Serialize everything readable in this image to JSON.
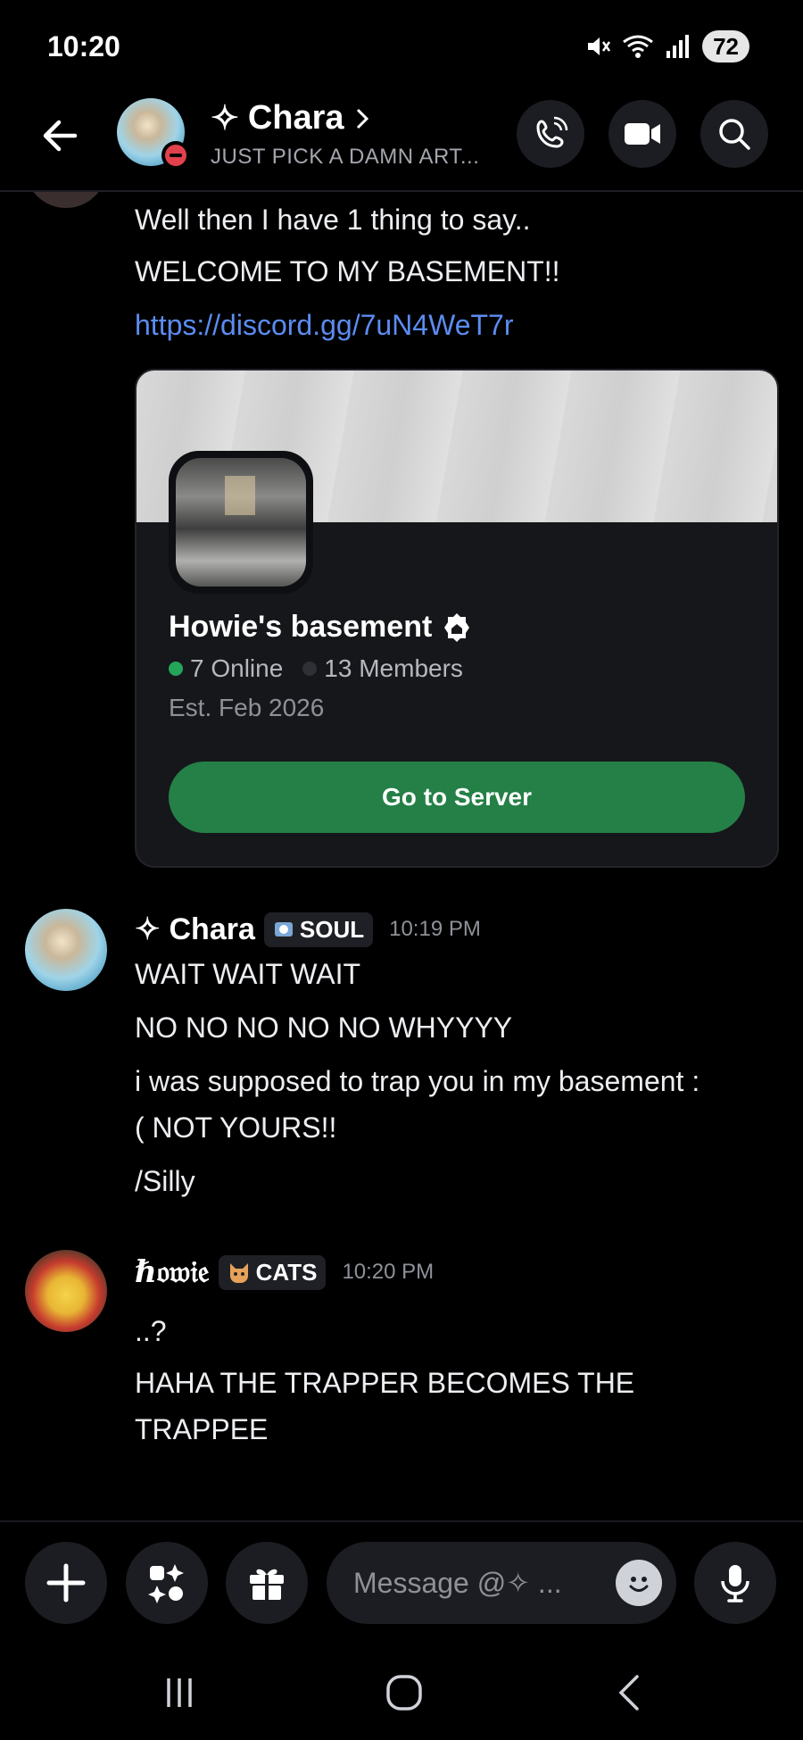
{
  "status_bar": {
    "time": "10:20",
    "battery": "72"
  },
  "header": {
    "title": "Chara",
    "title_prefix": "✧",
    "subtitle": "JUST PICK A DAMN ART..."
  },
  "messages": {
    "partial": {
      "lines": [
        "Well then I have 1 thing to say..",
        "WELCOME TO MY BASEMENT!!"
      ],
      "link": "https://discord.gg/7uN4WeT7r"
    },
    "invite": {
      "server_name": "Howie's basement",
      "online": "7 Online",
      "members": "13 Members",
      "established": "Est. Feb 2026",
      "button": "Go to Server",
      "colors": {
        "online_dot": "#23a55a",
        "members_dot": "#2e3035",
        "button": "#248046"
      }
    },
    "chara_msg": {
      "author": "Chara",
      "author_prefix": "✧",
      "tag": "SOUL",
      "time": "10:19 PM",
      "lines": [
        "WAIT WAIT WAIT",
        "NO NO NO NO NO WHYYYY",
        "i was supposed to trap you in my basement :",
        "( NOT YOURS!!",
        "/Silly"
      ]
    },
    "howie_msg": {
      "author": "ℏ𝔬𝔴𝔦𝔢",
      "tag": "CATS",
      "time": "10:20 PM",
      "lines": [
        "..?",
        "HAHA THE TRAPPER BECOMES THE",
        "TRAPPEE"
      ]
    }
  },
  "composer": {
    "placeholder": "Message @✧ ..."
  },
  "icons": {
    "back": "arrow-left-icon",
    "call": "phone-icon",
    "video": "video-camera-icon",
    "search": "search-icon",
    "plus": "plus-icon",
    "apps": "apps-icon",
    "gift": "gift-icon",
    "emoji": "emoji-icon",
    "mic": "microphone-icon"
  }
}
